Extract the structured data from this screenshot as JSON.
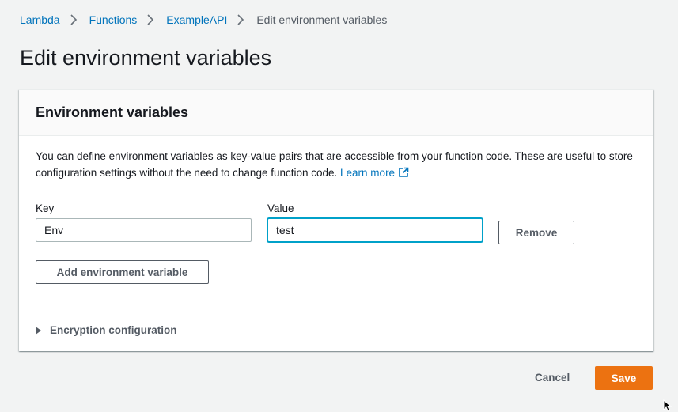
{
  "breadcrumb": {
    "items": [
      {
        "label": "Lambda"
      },
      {
        "label": "Functions"
      },
      {
        "label": "ExampleAPI"
      },
      {
        "label": "Edit environment variables"
      }
    ]
  },
  "page": {
    "title": "Edit environment variables"
  },
  "panel": {
    "title": "Environment variables",
    "description": "You can define environment variables as key-value pairs that are accessible from your function code. These are useful to store configuration settings without the need to change function code.",
    "learn_more": "Learn more",
    "key_label": "Key",
    "value_label": "Value",
    "variables": [
      {
        "key": "Env",
        "value": "test"
      }
    ],
    "remove_label": "Remove",
    "add_label": "Add environment variable",
    "encryption_label": "Encryption configuration"
  },
  "footer": {
    "cancel_label": "Cancel",
    "save_label": "Save"
  },
  "colors": {
    "link": "#0073bb",
    "primary": "#ec7211",
    "focus": "#00a1c9"
  },
  "icons": {
    "breadcrumb_separator": "chevron-right-icon",
    "learn_more": "external-link-icon",
    "expander": "caret-right-icon"
  }
}
